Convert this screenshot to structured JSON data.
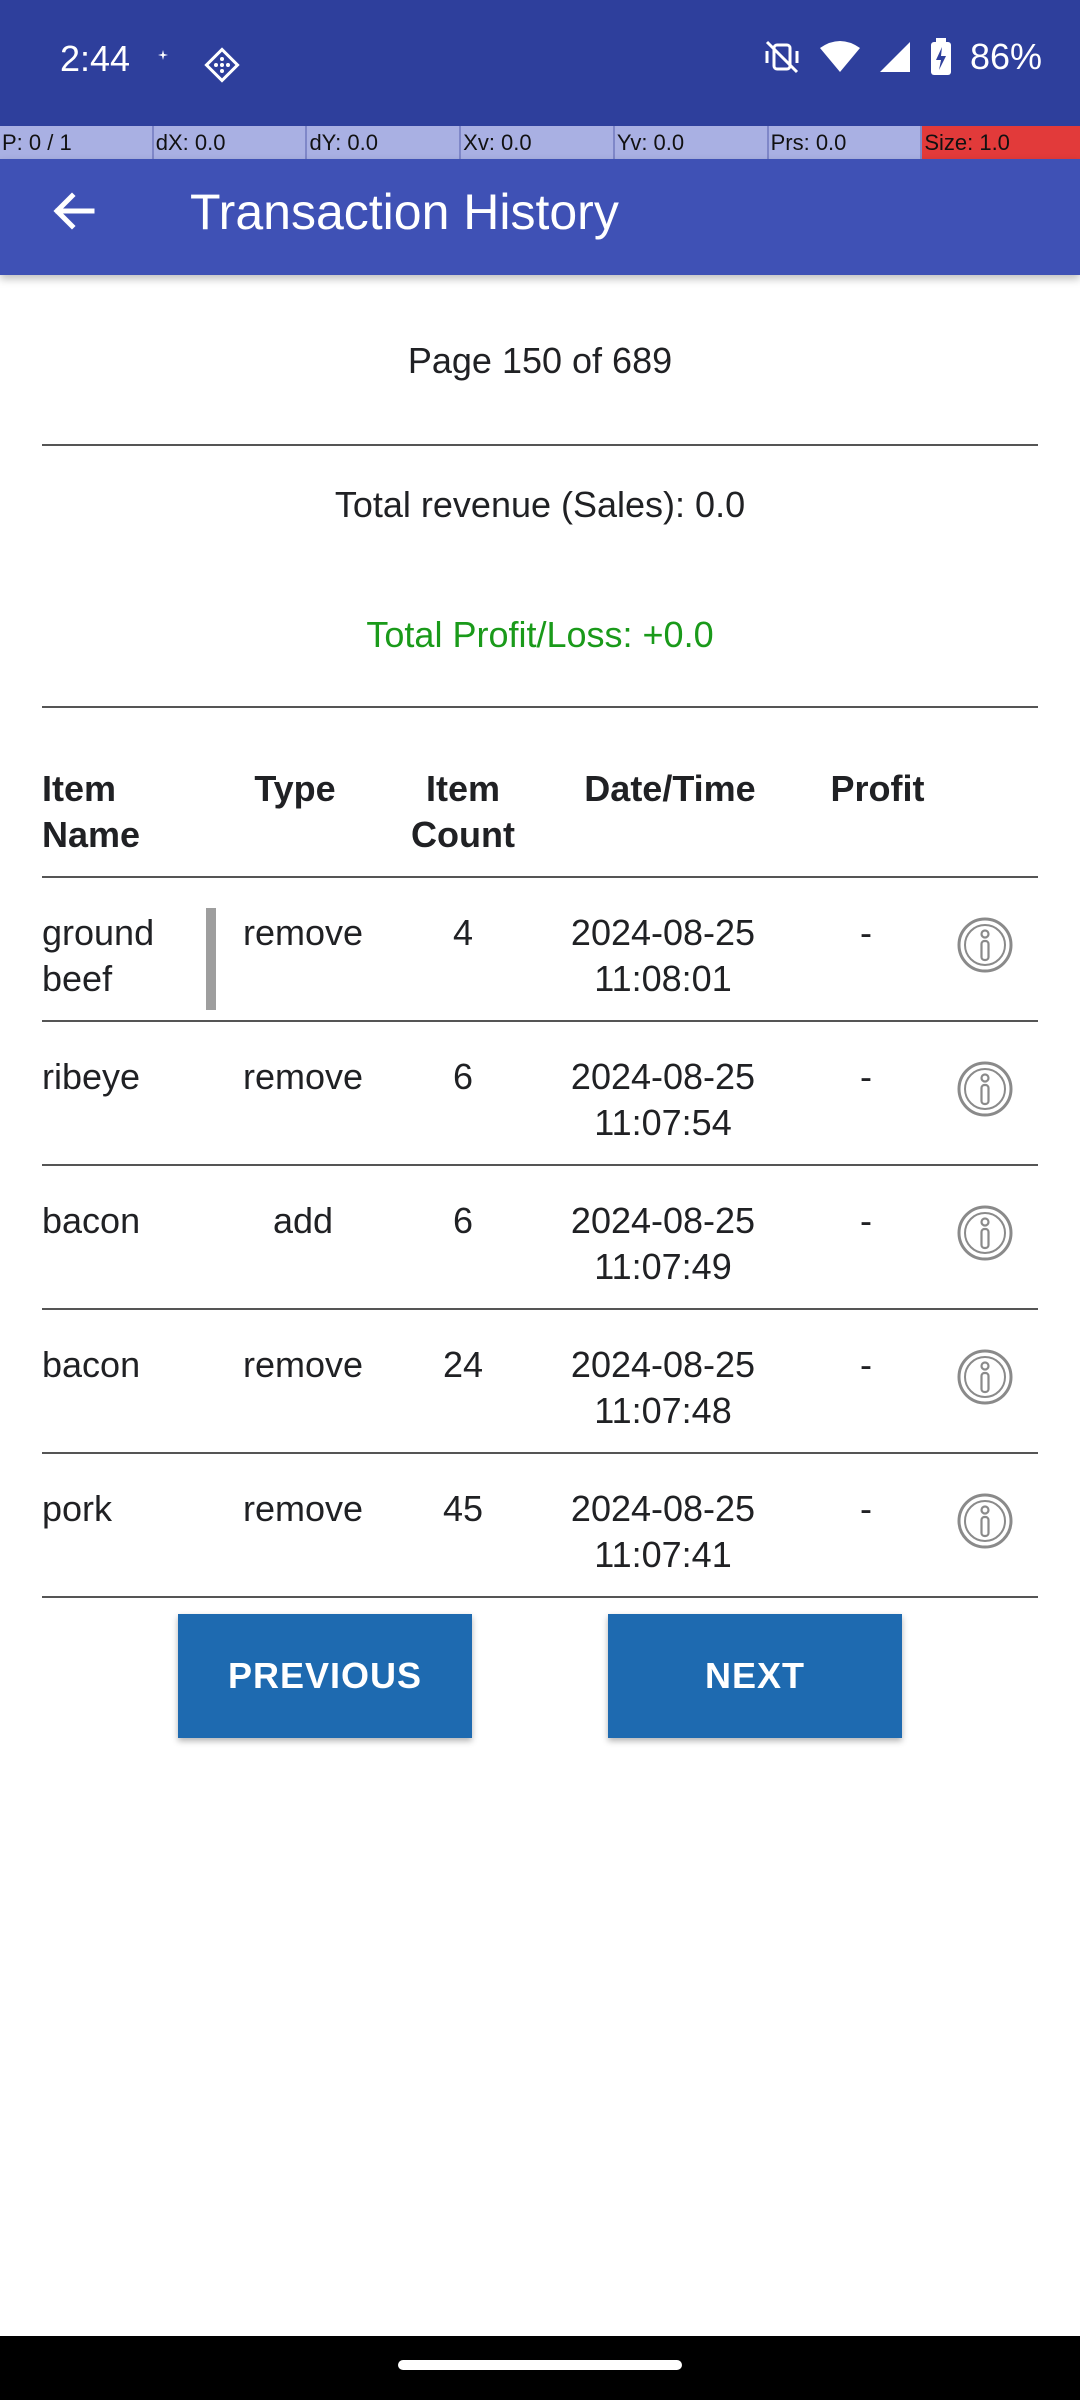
{
  "status_bar": {
    "time": "2:44",
    "battery": "86%"
  },
  "debug_bar": [
    "P: 0 / 1",
    "dX: 0.0",
    "dY: 0.0",
    "Xv: 0.0",
    "Yv: 0.0",
    "Prs: 0.0",
    "Size: 1.0"
  ],
  "app_bar": {
    "title": "Transaction History"
  },
  "page_info": "Page 150 of 689",
  "summary": {
    "revenue": "Total revenue (Sales): 0.0",
    "profit_loss": "Total Profit/Loss: +0.0",
    "profit_color": "#1a9a1a"
  },
  "table": {
    "headers": {
      "item_name": [
        "Item",
        "Name"
      ],
      "type": "Type",
      "item_count": [
        "Item",
        "Count"
      ],
      "datetime": "Date/Time",
      "profit": "Profit"
    },
    "rows": [
      {
        "name": [
          "ground",
          "beef"
        ],
        "type": "remove",
        "count": "4",
        "date": "2024-08-25",
        "time": "11:08:01",
        "profit": "-"
      },
      {
        "name": [
          "ribeye",
          ""
        ],
        "type": "remove",
        "count": "6",
        "date": "2024-08-25",
        "time": "11:07:54",
        "profit": "-"
      },
      {
        "name": [
          "bacon",
          ""
        ],
        "type": "add",
        "count": "6",
        "date": "2024-08-25",
        "time": "11:07:49",
        "profit": "-"
      },
      {
        "name": [
          "bacon",
          ""
        ],
        "type": "remove",
        "count": "24",
        "date": "2024-08-25",
        "time": "11:07:48",
        "profit": "-"
      },
      {
        "name": [
          "pork",
          ""
        ],
        "type": "remove",
        "count": "45",
        "date": "2024-08-25",
        "time": "11:07:41",
        "profit": "-"
      }
    ]
  },
  "buttons": {
    "previous": "PREVIOUS",
    "next": "NEXT"
  },
  "colors": {
    "status_bar": "#2e3f9c",
    "app_bar": "#3f51b5",
    "button": "#1e6ab0"
  }
}
